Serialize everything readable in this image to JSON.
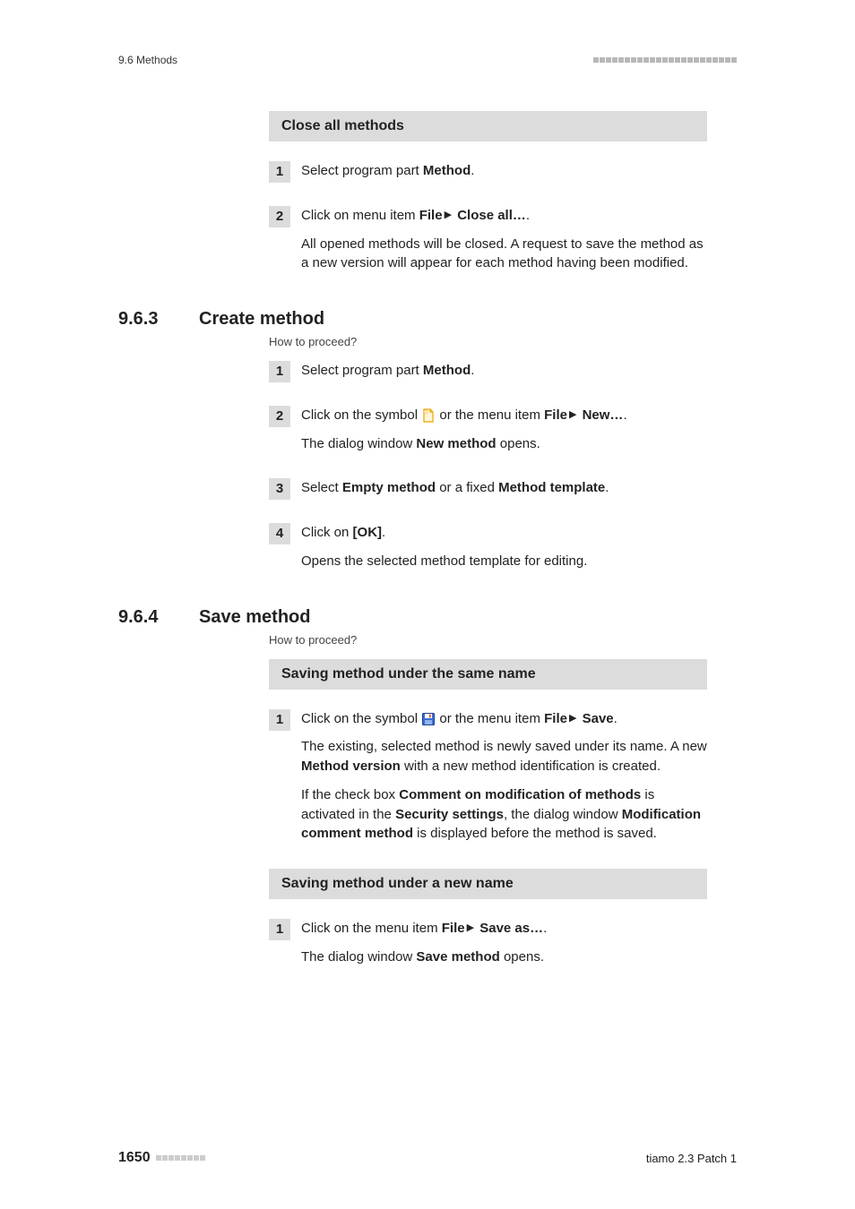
{
  "header": {
    "left": "9.6 Methods"
  },
  "closeAll": {
    "title": "Close all methods",
    "steps": [
      {
        "num": "1",
        "parts": [
          {
            "t": "Select program part "
          },
          {
            "t": "Method",
            "b": true
          },
          {
            "t": "."
          }
        ]
      },
      {
        "num": "2",
        "parts": [
          {
            "t": "Click on menu item "
          },
          {
            "t": "File",
            "b": true
          },
          {
            "arrow": true
          },
          {
            "t": "Close all…",
            "b": true
          },
          {
            "t": "."
          }
        ],
        "after": "All opened methods will be closed. A request to save the method as a new version will appear for each method having been modified."
      }
    ]
  },
  "section963": {
    "num": "9.6.3",
    "title": "Create method",
    "howto": "How to proceed?",
    "steps": [
      {
        "num": "1",
        "parts": [
          {
            "t": "Select program part "
          },
          {
            "t": "Method",
            "b": true
          },
          {
            "t": "."
          }
        ]
      },
      {
        "num": "2",
        "parts": [
          {
            "t": "Click on the symbol "
          },
          {
            "icon": "new"
          },
          {
            "t": " or the menu item "
          },
          {
            "t": "File",
            "b": true
          },
          {
            "arrow": true
          },
          {
            "t": "New…",
            "b": true
          },
          {
            "t": "."
          }
        ],
        "afterParts": [
          {
            "t": "The dialog window "
          },
          {
            "t": "New method",
            "b": true
          },
          {
            "t": " opens."
          }
        ]
      },
      {
        "num": "3",
        "parts": [
          {
            "t": "Select "
          },
          {
            "t": "Empty method",
            "b": true
          },
          {
            "t": " or a fixed "
          },
          {
            "t": "Method template",
            "b": true
          },
          {
            "t": "."
          }
        ]
      },
      {
        "num": "4",
        "parts": [
          {
            "t": "Click on "
          },
          {
            "t": "[OK]",
            "b": true
          },
          {
            "t": "."
          }
        ],
        "after": "Opens the selected method template for editing."
      }
    ]
  },
  "section964": {
    "num": "9.6.4",
    "title": "Save method",
    "howto": "How to proceed?",
    "block1": {
      "title": "Saving method under the same name",
      "steps": [
        {
          "num": "1",
          "parts": [
            {
              "t": "Click on the symbol "
            },
            {
              "icon": "save"
            },
            {
              "t": " or the menu item "
            },
            {
              "t": "File",
              "b": true
            },
            {
              "arrow": true
            },
            {
              "t": "Save",
              "b": true
            },
            {
              "t": "."
            }
          ],
          "afterBlocks": [
            [
              {
                "t": "The existing, selected method is newly saved under its name. A new "
              },
              {
                "t": "Method version",
                "b": true
              },
              {
                "t": " with a new method identification is created."
              }
            ],
            [
              {
                "t": "If the check box "
              },
              {
                "t": "Comment on modification of methods",
                "b": true
              },
              {
                "t": " is activated in the "
              },
              {
                "t": "Security settings",
                "b": true
              },
              {
                "t": ", the dialog window "
              },
              {
                "t": "Modification comment method",
                "b": true
              },
              {
                "t": " is displayed before the method is saved."
              }
            ]
          ]
        }
      ]
    },
    "block2": {
      "title": "Saving method under a new name",
      "steps": [
        {
          "num": "1",
          "parts": [
            {
              "t": "Click on the menu item "
            },
            {
              "t": "File",
              "b": true
            },
            {
              "arrow": true
            },
            {
              "t": "Save as…",
              "b": true
            },
            {
              "t": "."
            }
          ],
          "afterParts": [
            {
              "t": "The dialog window "
            },
            {
              "t": "Save method",
              "b": true
            },
            {
              "t": " opens."
            }
          ]
        }
      ]
    }
  },
  "footer": {
    "page": "1650",
    "right": "tiamo 2.3 Patch 1"
  }
}
